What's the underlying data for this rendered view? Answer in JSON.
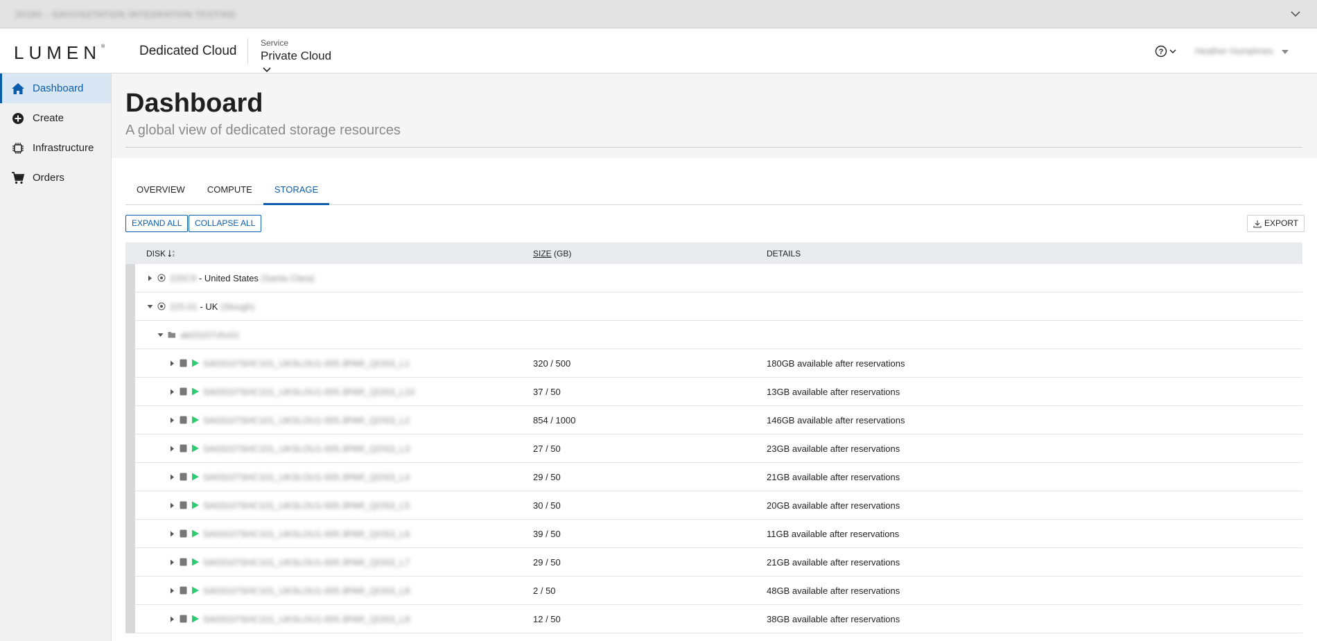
{
  "banner": {
    "text": "2019X - SAVVISSTATION INTEGRATION TESTING"
  },
  "header": {
    "logo": "LUMEN",
    "logo_mark": "®",
    "product": "Dedicated Cloud",
    "service_label": "Service",
    "service_value": "Private Cloud",
    "user_name": "Heather Humphries"
  },
  "sidebar": {
    "items": [
      {
        "label": "Dashboard",
        "icon": "home-icon",
        "active": true
      },
      {
        "label": "Create",
        "icon": "plus-circle-icon",
        "active": false
      },
      {
        "label": "Infrastructure",
        "icon": "chip-icon",
        "active": false
      },
      {
        "label": "Orders",
        "icon": "cart-icon",
        "active": false
      }
    ]
  },
  "page": {
    "title": "Dashboard",
    "subtitle": "A global view of dedicated storage resources"
  },
  "tabs": [
    {
      "label": "OVERVIEW",
      "active": false
    },
    {
      "label": "COMPUTE",
      "active": false
    },
    {
      "label": "STORAGE",
      "active": true
    }
  ],
  "toolbar": {
    "expand_all": "EXPAND ALL",
    "collapse_all": "COLLAPSE ALL",
    "export": "EXPORT"
  },
  "table": {
    "headers": {
      "disk": "DISK",
      "size": "SIZE",
      "size_unit": "(GB)",
      "details": "DETAILS"
    },
    "locations": [
      {
        "id": "225C9",
        "country": "- United States",
        "city": "(Santa Clara)",
        "expanded": false
      },
      {
        "id": "225.01",
        "country": "- UK",
        "city": "(Slough)",
        "expanded": true
      }
    ],
    "folder": "ab03107vhc01",
    "disks": [
      {
        "name": "SA03107SHC101_UKSLOU1-005.3PAR_QOS3_L1",
        "size": "320 / 500",
        "details": "180GB available after reservations"
      },
      {
        "name": "SA03107SHC101_UKSLOU1-005.3PAR_QOS3_L10",
        "size": "37 / 50",
        "details": "13GB available after reservations"
      },
      {
        "name": "SA03107SHC101_UKSLOU1-005.3PAR_QOS3_L2",
        "size": "854 / 1000",
        "details": "146GB available after reservations"
      },
      {
        "name": "SA03107SHC101_UKSLOU1-005.3PAR_QOS3_L3",
        "size": "27 / 50",
        "details": "23GB available after reservations"
      },
      {
        "name": "SA03107SHC101_UKSLOU1-005.3PAR_QOS3_L4",
        "size": "29 / 50",
        "details": "21GB available after reservations"
      },
      {
        "name": "SA03107SHC101_UKSLOU1-005.3PAR_QOS3_L5",
        "size": "30 / 50",
        "details": "20GB available after reservations"
      },
      {
        "name": "SA03107SHC101_UKSLOU1-005.3PAR_QOS3_L6",
        "size": "39 / 50",
        "details": "11GB available after reservations"
      },
      {
        "name": "SA03107SHC101_UKSLOU1-005.3PAR_QOS3_L7",
        "size": "29 / 50",
        "details": "21GB available after reservations"
      },
      {
        "name": "SA03107SHC101_UKSLOU1-005.3PAR_QOS3_L8",
        "size": "2 / 50",
        "details": "48GB available after reservations"
      },
      {
        "name": "SA03107SHC101_UKSLOU1-005.3PAR_QOS3_L9",
        "size": "12 / 50",
        "details": "38GB available after reservations"
      }
    ]
  },
  "colors": {
    "accent": "#0b5cab",
    "status_green": "#2ecc71",
    "sidebar_active_bg": "#d9e6f4"
  }
}
